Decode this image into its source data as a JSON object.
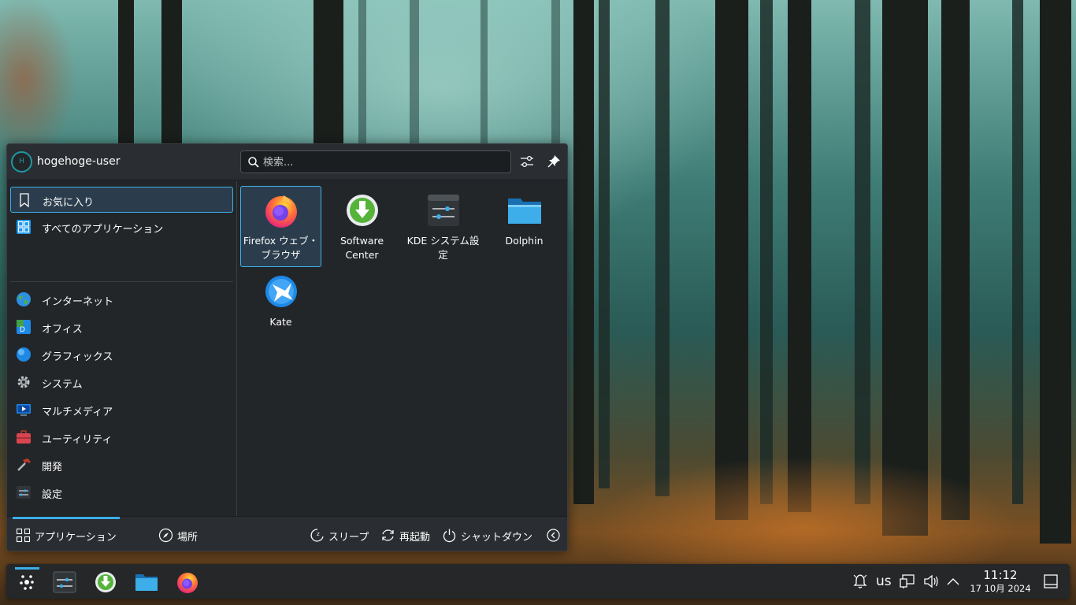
{
  "launcher": {
    "username": "hogehoge-user",
    "avatar_initial": "H",
    "search_placeholder": "検索...",
    "categories": [
      {
        "label": "お気に入り",
        "icon": "bookmark-icon"
      },
      {
        "label": "すべてのアプリケーション",
        "icon": "grid-icon"
      },
      {
        "label": "インターネット",
        "icon": "globe-icon"
      },
      {
        "label": "オフィス",
        "icon": "office-icon"
      },
      {
        "label": "グラフィックス",
        "icon": "graphics-icon"
      },
      {
        "label": "システム",
        "icon": "gear-icon"
      },
      {
        "label": "マルチメディア",
        "icon": "multimedia-icon"
      },
      {
        "label": "ユーティリティ",
        "icon": "toolbox-icon"
      },
      {
        "label": "開発",
        "icon": "hammer-icon"
      },
      {
        "label": "設定",
        "icon": "settings-icon"
      }
    ],
    "apps": [
      {
        "label": "Firefox ウェブ・ブラウザ",
        "icon": "firefox-icon"
      },
      {
        "label": "Software Center",
        "icon": "software-center-icon"
      },
      {
        "label": "KDE システム設定",
        "icon": "system-settings-icon"
      },
      {
        "label": "Dolphin",
        "icon": "folder-icon"
      },
      {
        "label": "Kate",
        "icon": "kate-icon"
      }
    ],
    "footer": {
      "applications": "アプリケーション",
      "places": "場所",
      "sleep": "スリープ",
      "restart": "再起動",
      "shutdown": "シャットダウン"
    }
  },
  "taskbar": {
    "keyboard_layout": "us",
    "time": "11:12",
    "date": "17 10月 2024"
  },
  "colors": {
    "accent": "#3daee9",
    "panel": "#232629"
  }
}
